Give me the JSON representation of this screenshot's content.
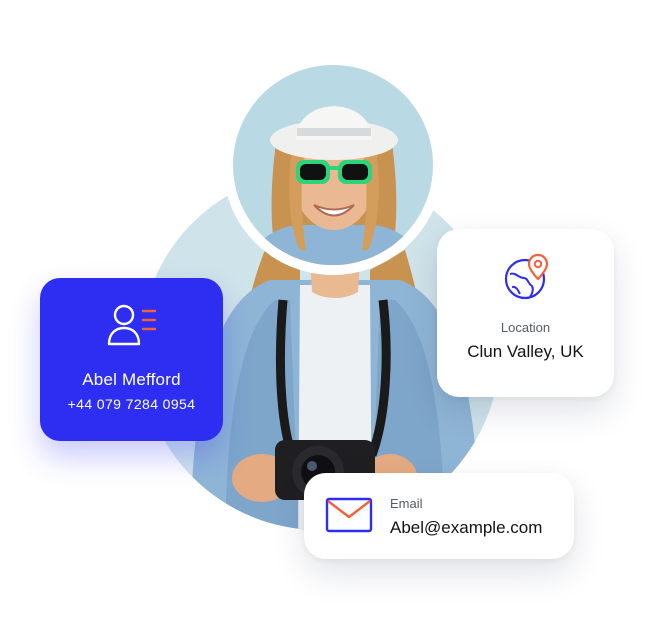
{
  "contact_card": {
    "name": "Abel Mefford",
    "phone": "+44 079 7284 0954",
    "icon": "user-list-icon"
  },
  "location_card": {
    "label": "Location",
    "value": "Clun Valley, UK",
    "icon": "globe-pin-icon"
  },
  "email_card": {
    "label": "Email",
    "value": "Abel@example.com",
    "icon": "envelope-icon"
  },
  "colors": {
    "accent_blue": "#2d2ef2",
    "accent_orange": "#f3603a",
    "backdrop_circle": "#cfe3ea"
  }
}
